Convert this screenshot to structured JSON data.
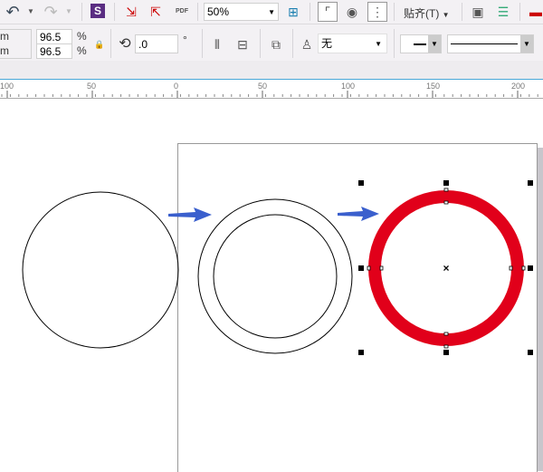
{
  "toolbar": {
    "zoom_value": "50%",
    "snap_label": "贴齐(T)",
    "rotation_value": ".0",
    "degree_unit": "°",
    "outline_value": "无"
  },
  "size": {
    "unit1": "m",
    "unit2": "m",
    "scale_x": "96.5",
    "scale_y": "96.5",
    "pct": "%"
  },
  "ruler": {
    "ticks": [
      "100",
      "50",
      "0",
      "50",
      "100",
      "150",
      "200"
    ]
  },
  "colors": {
    "ring": "#e1001a",
    "arrow": "#3a5fcd",
    "accent": "#4aa8d8"
  },
  "icons": [
    "undo-icon",
    "redo-icon",
    "app-launcher-icon",
    "import-icon",
    "export-icon",
    "pdf-icon",
    "fullscreen-icon",
    "rulers-icon",
    "grid-icon",
    "guidelines-icon",
    "options-icon",
    "checklist-icon",
    "lock-ratio-icon",
    "rotate-icon",
    "mirror-h-icon",
    "mirror-v-icon",
    "transform-icon",
    "pen-icon"
  ]
}
